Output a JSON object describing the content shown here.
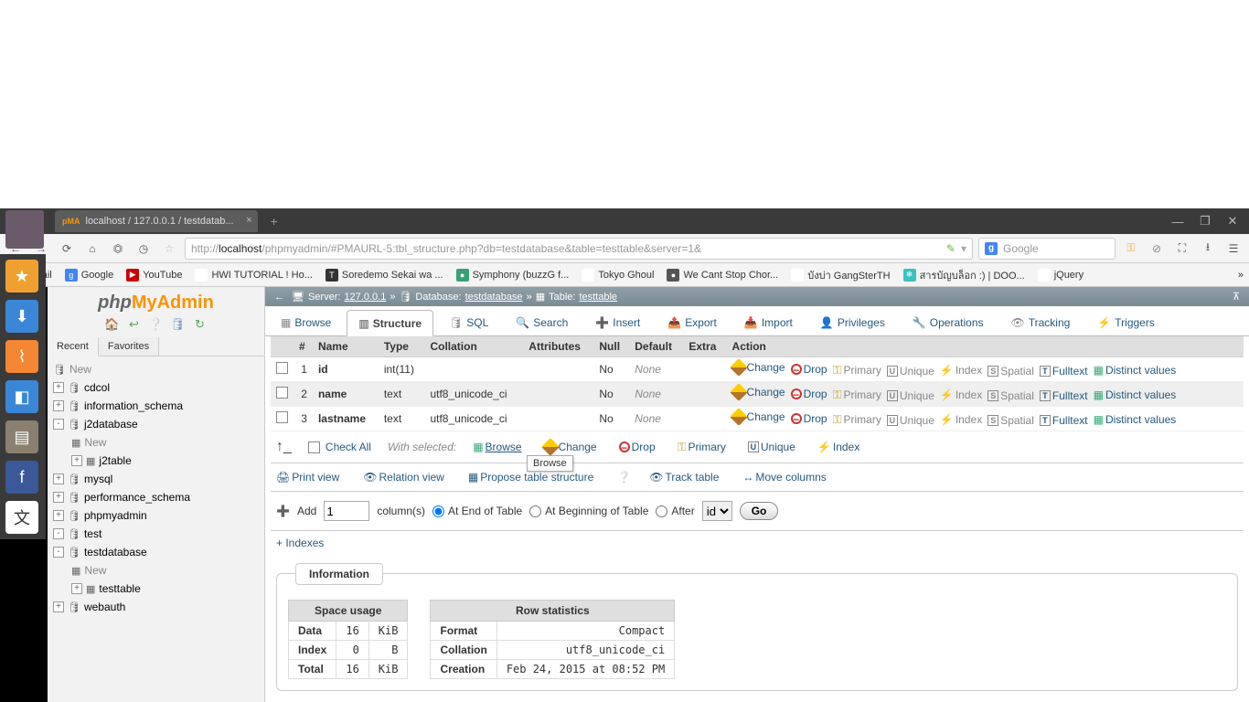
{
  "browser": {
    "tab_title": "localhost / 127.0.0.1 / testdatab...",
    "url_proto": "http://",
    "url_host": "localhost",
    "url_path": "/phpmyadmin/#PMAURL-5:tbl_structure.php?db=testdatabase&table=testtable&server=1&",
    "search_placeholder": "Google"
  },
  "bookmarks": [
    {
      "label": "Gmail",
      "color": "#d14836",
      "letter": "M"
    },
    {
      "label": "Google",
      "color": "#4285f4",
      "letter": "g"
    },
    {
      "label": "YouTube",
      "color": "#cc0000",
      "letter": "▶"
    },
    {
      "label": "HWI TUTORIAL ! Ho...",
      "color": "#fff",
      "letter": ""
    },
    {
      "label": "Soredemo Sekai wa ...",
      "color": "#333",
      "letter": "T"
    },
    {
      "label": "Symphony   (buzzG f...",
      "color": "#39a275",
      "letter": "●"
    },
    {
      "label": "Tokyo Ghoul",
      "color": "#fff",
      "letter": ""
    },
    {
      "label": "We Cant Stop Chor...",
      "color": "#555",
      "letter": "●"
    },
    {
      "label": "บังบ่า GangSterTH",
      "color": "#fff",
      "letter": ""
    },
    {
      "label": "สารบัญบล็อก :) | DOO...",
      "color": "#3ac1c1",
      "letter": "❄"
    },
    {
      "label": "jQuery",
      "color": "#fff",
      "letter": ""
    }
  ],
  "sidebar": {
    "tabs": {
      "recent": "Recent",
      "favorites": "Favorites"
    },
    "new": "New",
    "databases": [
      {
        "name": "cdcol",
        "expand": "+"
      },
      {
        "name": "information_schema",
        "expand": "+"
      },
      {
        "name": "j2database",
        "expand": "-",
        "children": [
          {
            "new": "New"
          },
          {
            "name": "j2table",
            "expand": "+"
          }
        ]
      },
      {
        "name": "mysql",
        "expand": "+"
      },
      {
        "name": "performance_schema",
        "expand": "+"
      },
      {
        "name": "phpmyadmin",
        "expand": "+"
      },
      {
        "name": "test",
        "expand": "-"
      },
      {
        "name": "testdatabase",
        "expand": "-",
        "children": [
          {
            "new": "New"
          },
          {
            "name": "testtable",
            "expand": "+"
          }
        ]
      },
      {
        "name": "webauth",
        "expand": "+"
      }
    ]
  },
  "crumb": {
    "server_label": "Server:",
    "server": "127.0.0.1",
    "db_label": "Database:",
    "db": "testdatabase",
    "tbl_label": "Table:",
    "tbl": "testtable"
  },
  "tabs": [
    "Browse",
    "Structure",
    "SQL",
    "Search",
    "Insert",
    "Export",
    "Import",
    "Privileges",
    "Operations",
    "Tracking",
    "Triggers"
  ],
  "active_tab": "Structure",
  "columns": {
    "headers": [
      "#",
      "Name",
      "Type",
      "Collation",
      "Attributes",
      "Null",
      "Default",
      "Extra",
      "Action"
    ],
    "rows": [
      {
        "num": "1",
        "name": "id",
        "type": "int(11)",
        "collation": "",
        "null": "No",
        "default": "None"
      },
      {
        "num": "2",
        "name": "name",
        "type": "text",
        "collation": "utf8_unicode_ci",
        "null": "No",
        "default": "None"
      },
      {
        "num": "3",
        "name": "lastname",
        "type": "text",
        "collation": "utf8_unicode_ci",
        "null": "No",
        "default": "None"
      }
    ],
    "actions": {
      "change": "Change",
      "drop": "Drop",
      "primary": "Primary",
      "unique": "Unique",
      "index": "Index",
      "spatial": "Spatial",
      "fulltext": "Fulltext",
      "distinct": "Distinct values"
    }
  },
  "checkall": {
    "label": "Check All",
    "with": "With selected:",
    "browse": "Browse",
    "change": "Change",
    "drop": "Drop",
    "primary": "Primary",
    "unique": "Unique",
    "index": "Index",
    "tooltip": "Browse"
  },
  "links": {
    "print": "Print view",
    "relation": "Relation view",
    "propose": "Propose table structure",
    "track": "Track table",
    "move": "Move columns"
  },
  "add": {
    "prefix": "Add",
    "value": "1",
    "suffix": "column(s)",
    "opt_end": "At End of Table",
    "opt_begin": "At Beginning of Table",
    "opt_after": "After",
    "after_sel": "id",
    "go": "Go"
  },
  "indexes_link": "+ Indexes",
  "info": {
    "title": "Information",
    "space": {
      "title": "Space usage",
      "rows": [
        [
          "Data",
          "16",
          "KiB"
        ],
        [
          "Index",
          "0",
          "B"
        ],
        [
          "Total",
          "16",
          "KiB"
        ]
      ]
    },
    "stats": {
      "title": "Row statistics",
      "rows": [
        [
          "Format",
          "Compact"
        ],
        [
          "Collation",
          "utf8_unicode_ci"
        ],
        [
          "Creation",
          "Feb 24, 2015 at 08:52 PM"
        ]
      ]
    }
  }
}
